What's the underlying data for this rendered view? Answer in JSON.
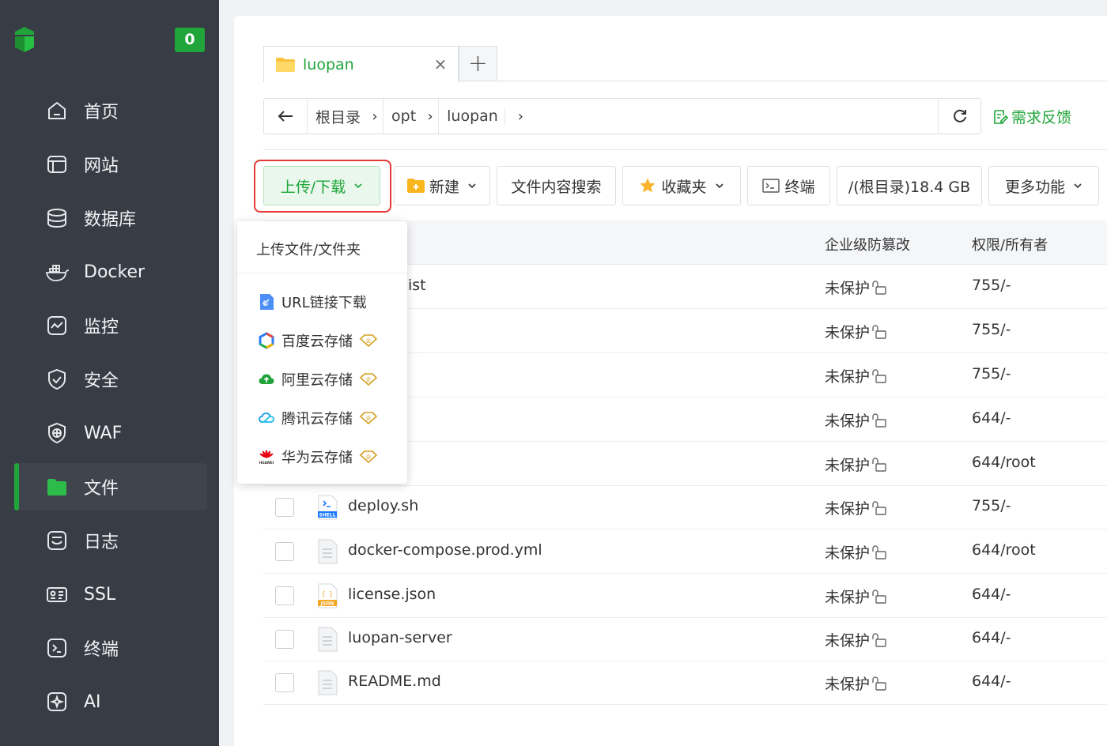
{
  "sidebar": {
    "badge": "0",
    "items": [
      {
        "label": "首页",
        "icon": "home-icon"
      },
      {
        "label": "网站",
        "icon": "website-icon"
      },
      {
        "label": "数据库",
        "icon": "database-icon"
      },
      {
        "label": "Docker",
        "icon": "docker-icon"
      },
      {
        "label": "监控",
        "icon": "monitor-icon"
      },
      {
        "label": "安全",
        "icon": "shield-icon"
      },
      {
        "label": "WAF",
        "icon": "waf-icon"
      },
      {
        "label": "文件",
        "icon": "folder-icon",
        "active": true
      },
      {
        "label": "日志",
        "icon": "log-icon"
      },
      {
        "label": "SSL",
        "icon": "ssl-icon"
      },
      {
        "label": "终端",
        "icon": "terminal-icon"
      },
      {
        "label": "AI",
        "icon": "ai-icon"
      }
    ]
  },
  "tabs": {
    "active": "luopan",
    "close": "×",
    "add": "+"
  },
  "breadcrumb": {
    "items": [
      "根目录",
      "opt",
      "luopan"
    ]
  },
  "feedback": "需求反馈",
  "toolbar": {
    "upload": "上传/下载",
    "new": "新建",
    "search": "文件内容搜索",
    "favorites": "收藏夹",
    "terminal": "终端",
    "disk": "/(根目录)18.4 GB",
    "more": "更多功能"
  },
  "table": {
    "headers": {
      "protect": "企业级防篡改",
      "perm": "权限/所有者"
    },
    "rows": [
      {
        "name": "ist",
        "protect": "未保护",
        "perm": "755/-"
      },
      {
        "name": "",
        "protect": "未保护",
        "perm": "755/-"
      },
      {
        "name": "",
        "protect": "未保护",
        "perm": "755/-"
      },
      {
        "name": "",
        "protect": "未保护",
        "perm": "644/-"
      },
      {
        "name": "",
        "protect": "未保护",
        "perm": "644/root"
      },
      {
        "name": "deploy.sh",
        "protect": "未保护",
        "perm": "755/-",
        "icon": "shell-file-icon",
        "icon_label": "SHELL"
      },
      {
        "name": "docker-compose.prod.yml",
        "protect": "未保护",
        "perm": "644/root",
        "icon": "file-icon"
      },
      {
        "name": "license.json",
        "protect": "未保护",
        "perm": "644/-",
        "icon": "json-file-icon",
        "icon_label": "JSON",
        "icon_glyph": "{ }"
      },
      {
        "name": "luopan-server",
        "protect": "未保护",
        "perm": "644/-",
        "icon": "file-icon"
      },
      {
        "name": "README.md",
        "protect": "未保护",
        "perm": "644/-",
        "icon": "file-icon"
      }
    ]
  },
  "dropdown": {
    "header": "上传文件/文件夹",
    "items": [
      {
        "label": "URL链接下载",
        "icon": "link-icon"
      },
      {
        "label": "百度云存储",
        "icon": "baidu-cloud-icon",
        "pro": true
      },
      {
        "label": "阿里云存储",
        "icon": "aliyun-icon",
        "pro": true
      },
      {
        "label": "腾讯云存储",
        "icon": "tencent-cloud-icon",
        "pro": true
      },
      {
        "label": "华为云存储",
        "icon": "huawei-cloud-icon",
        "pro": true
      }
    ],
    "pro_glyph": "企",
    "huawei_text": "HUAWEI"
  },
  "colors": {
    "brand": "#20a53a",
    "sidebar": "#373c45",
    "highlight": "#e53935"
  }
}
